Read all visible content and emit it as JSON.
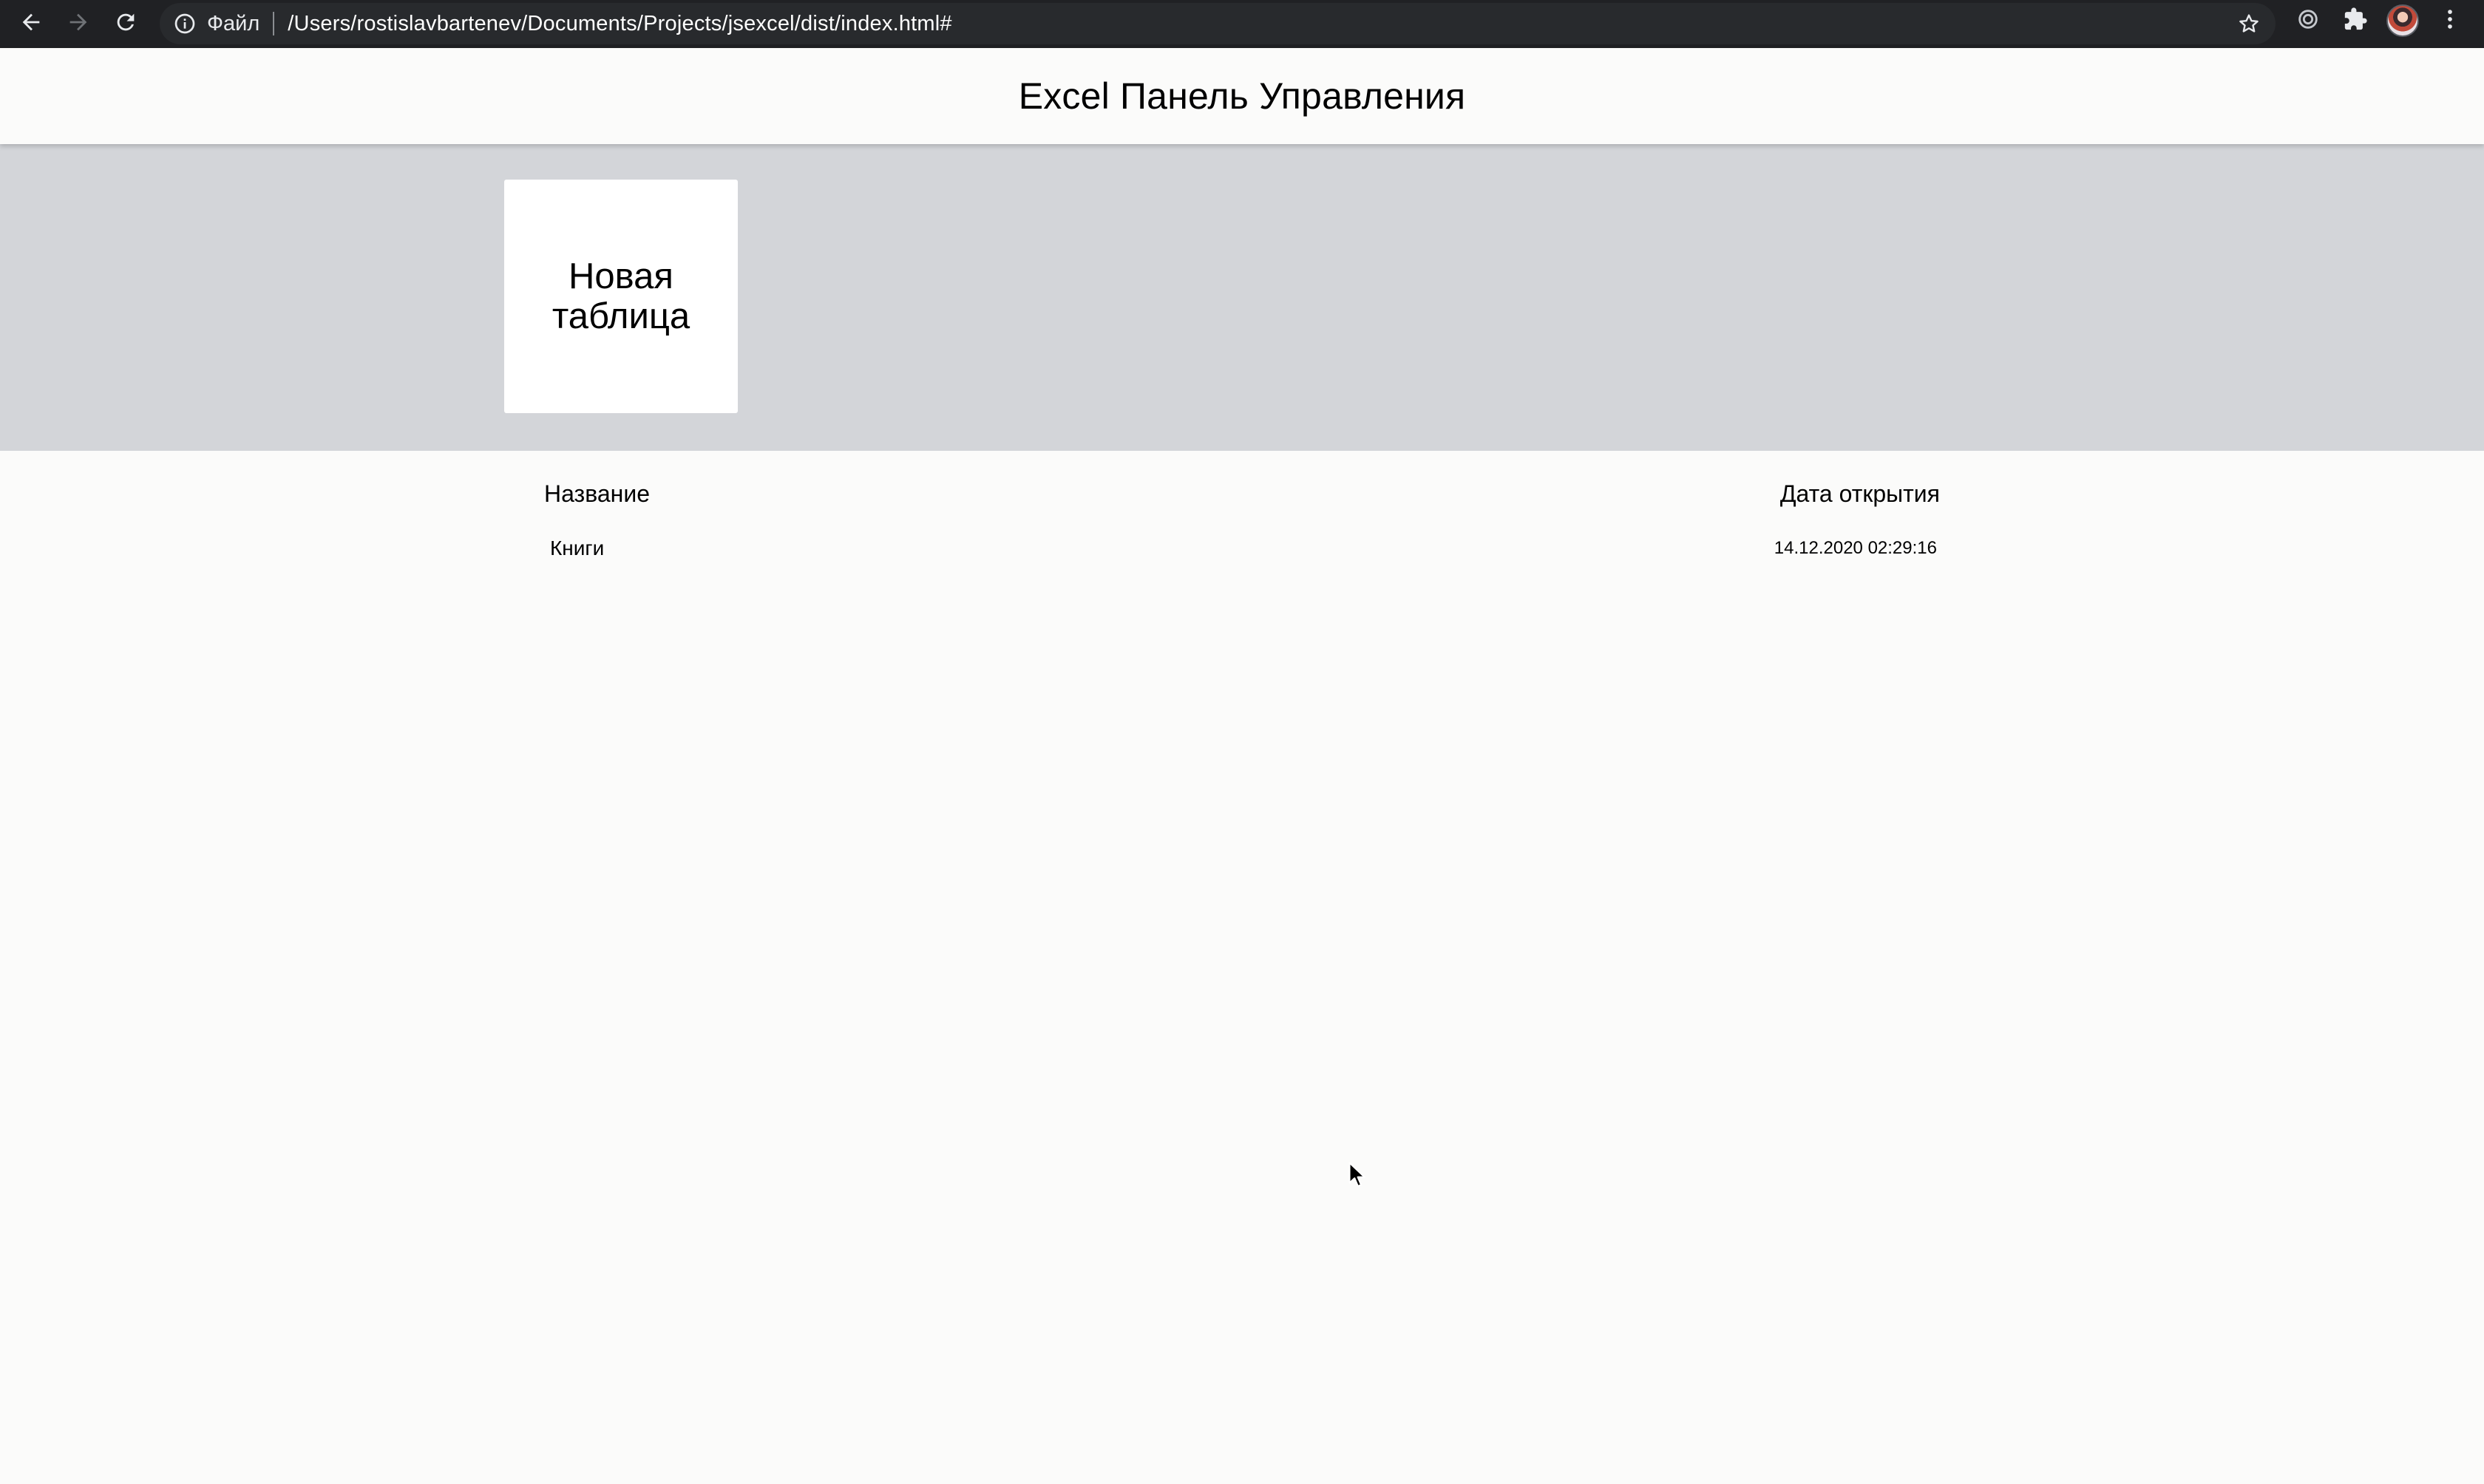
{
  "browser": {
    "scheme_label": "Файл",
    "url": "/Users/rostislavbartenev/Documents/Projects/jsexcel/dist/index.html#",
    "icons": [
      "back-icon",
      "forward-icon",
      "reload-icon",
      "info-icon",
      "star-icon",
      "circle-target-icon",
      "puzzle-icon",
      "avatar",
      "kebab-menu-icon"
    ]
  },
  "header": {
    "title": "Excel Панель Управления"
  },
  "create": {
    "new_table_label": "Новая таблица"
  },
  "list": {
    "columns": {
      "name": "Название",
      "date": "Дата открытия"
    },
    "rows": [
      {
        "name": "Книги",
        "date": "14.12.2020 02:29:16"
      }
    ]
  },
  "colors": {
    "browser_bar": "#202124",
    "omnibox": "#282a2d",
    "page_bg": "#fbfbfa",
    "create_area_bg": "#d3d5d9",
    "card_bg": "#ffffff"
  }
}
